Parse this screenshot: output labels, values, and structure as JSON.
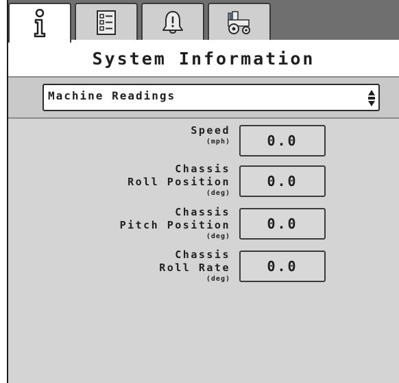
{
  "tabs": [
    {
      "icon": "info-icon",
      "active": true
    },
    {
      "icon": "checklist-icon",
      "active": false
    },
    {
      "icon": "alarm-bell-icon",
      "active": false
    },
    {
      "icon": "tractor-icon",
      "active": false
    }
  ],
  "title": "System Information",
  "dropdown": {
    "value": "Machine Readings"
  },
  "readings": [
    {
      "lines": [
        "Speed"
      ],
      "unit": "(mph)",
      "value": "0.0"
    },
    {
      "lines": [
        "Chassis",
        "Roll Position"
      ],
      "unit": "(deg)",
      "value": "0.0"
    },
    {
      "lines": [
        "Chassis",
        "Pitch Position"
      ],
      "unit": "(deg)",
      "value": "0.0"
    },
    {
      "lines": [
        "Chassis",
        "Roll Rate"
      ],
      "unit": "(deg)",
      "value": "0.0"
    }
  ],
  "colors": {
    "tabbar_bg": "#6f6f6f",
    "panel_bg": "#d4d4d4",
    "text": "#1f1f1f"
  }
}
